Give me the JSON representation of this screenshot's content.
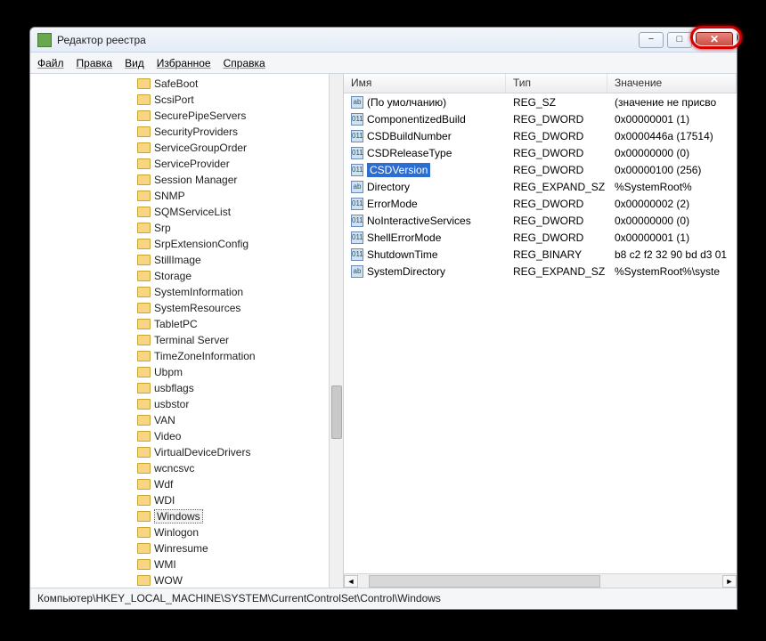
{
  "window": {
    "title": "Редактор реестра"
  },
  "menu": {
    "file": "Файл",
    "edit": "Правка",
    "view": "Вид",
    "favorites": "Избранное",
    "help": "Справка"
  },
  "tree": {
    "items": [
      {
        "label": "SafeBoot"
      },
      {
        "label": "ScsiPort"
      },
      {
        "label": "SecurePipeServers"
      },
      {
        "label": "SecurityProviders"
      },
      {
        "label": "ServiceGroupOrder"
      },
      {
        "label": "ServiceProvider"
      },
      {
        "label": "Session Manager"
      },
      {
        "label": "SNMP"
      },
      {
        "label": "SQMServiceList"
      },
      {
        "label": "Srp"
      },
      {
        "label": "SrpExtensionConfig"
      },
      {
        "label": "StillImage"
      },
      {
        "label": "Storage"
      },
      {
        "label": "SystemInformation"
      },
      {
        "label": "SystemResources"
      },
      {
        "label": "TabletPC"
      },
      {
        "label": "Terminal Server"
      },
      {
        "label": "TimeZoneInformation"
      },
      {
        "label": "Ubpm"
      },
      {
        "label": "usbflags"
      },
      {
        "label": "usbstor"
      },
      {
        "label": "VAN"
      },
      {
        "label": "Video"
      },
      {
        "label": "VirtualDeviceDrivers"
      },
      {
        "label": "wcncsvc"
      },
      {
        "label": "Wdf"
      },
      {
        "label": "WDI"
      },
      {
        "label": "Windows",
        "selected": true
      },
      {
        "label": "Winlogon"
      },
      {
        "label": "Winresume"
      },
      {
        "label": "WMI"
      },
      {
        "label": "WOW"
      }
    ]
  },
  "list": {
    "columns": {
      "name": "Имя",
      "type": "Тип",
      "value": "Значение"
    },
    "rows": [
      {
        "icon": "ab",
        "name": "(По умолчанию)",
        "type": "REG_SZ",
        "value": "(значение не присво",
        "selected": false
      },
      {
        "icon": "011",
        "name": "ComponentizedBuild",
        "type": "REG_DWORD",
        "value": "0x00000001 (1)",
        "selected": false
      },
      {
        "icon": "011",
        "name": "CSDBuildNumber",
        "type": "REG_DWORD",
        "value": "0x0000446a (17514)",
        "selected": false
      },
      {
        "icon": "011",
        "name": "CSDReleaseType",
        "type": "REG_DWORD",
        "value": "0x00000000 (0)",
        "selected": false
      },
      {
        "icon": "011",
        "name": "CSDVersion",
        "type": "REG_DWORD",
        "value": "0x00000100 (256)",
        "selected": true
      },
      {
        "icon": "ab",
        "name": "Directory",
        "type": "REG_EXPAND_SZ",
        "value": "%SystemRoot%",
        "selected": false
      },
      {
        "icon": "011",
        "name": "ErrorMode",
        "type": "REG_DWORD",
        "value": "0x00000002 (2)",
        "selected": false
      },
      {
        "icon": "011",
        "name": "NoInteractiveServices",
        "type": "REG_DWORD",
        "value": "0x00000000 (0)",
        "selected": false
      },
      {
        "icon": "011",
        "name": "ShellErrorMode",
        "type": "REG_DWORD",
        "value": "0x00000001 (1)",
        "selected": false
      },
      {
        "icon": "011",
        "name": "ShutdownTime",
        "type": "REG_BINARY",
        "value": "b8 c2 f2 32 90 bd d3 01",
        "selected": false
      },
      {
        "icon": "ab",
        "name": "SystemDirectory",
        "type": "REG_EXPAND_SZ",
        "value": "%SystemRoot%\\syste",
        "selected": false
      }
    ]
  },
  "statusbar": {
    "path": "Компьютер\\HKEY_LOCAL_MACHINE\\SYSTEM\\CurrentControlSet\\Control\\Windows"
  }
}
